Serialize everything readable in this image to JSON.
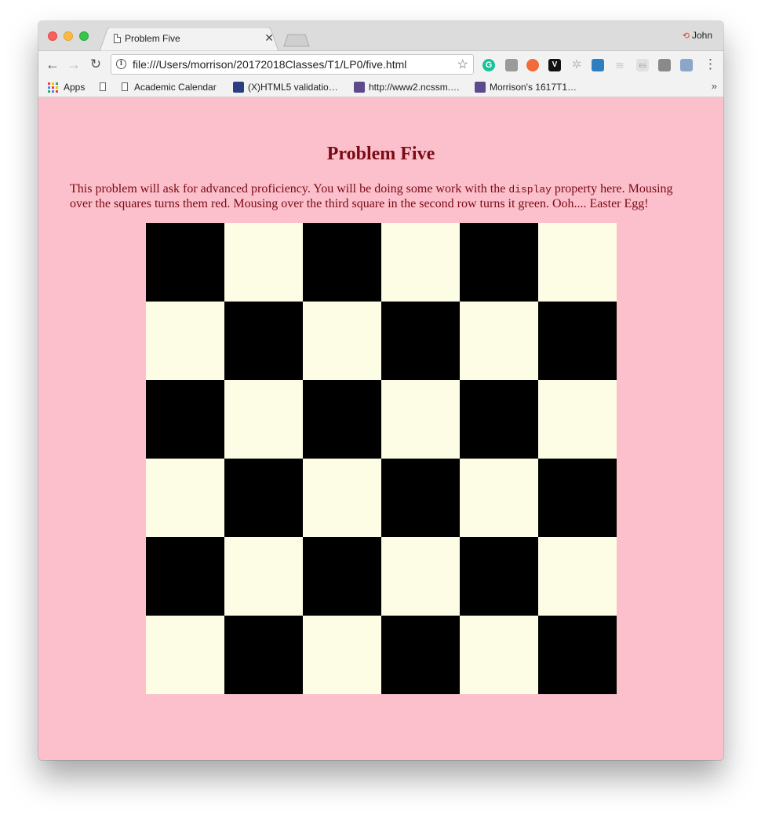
{
  "browser": {
    "tab_title": "Problem Five",
    "tab_close": "✕",
    "profile_name": "John",
    "url": "file:///Users/morrison/20172018Classes/T1/LP0/five.html",
    "bookmarks": [
      {
        "label": "Apps"
      },
      {
        "label": ""
      },
      {
        "label": "Academic Calendar"
      },
      {
        "label": "(X)HTML5 validatio…"
      },
      {
        "label": "http://www2.ncssm.…"
      },
      {
        "label": "Morrison's 1617T1…"
      }
    ],
    "bookmarks_overflow": "»",
    "extensions": [
      "grammarly-icon",
      "extension-icon",
      "orange-extension-icon",
      "vimeo-icon",
      "gray-extension-icon",
      "key-extension-icon",
      "feed-extension-icon",
      "es-extension-icon",
      "pocket-extension-icon",
      "printer-extension-icon"
    ],
    "extension_glyphs": {
      "grammarly": "G",
      "vimeo": "V",
      "es": "ES"
    }
  },
  "page": {
    "title": "Problem Five",
    "description_before_code": "This problem will ask for advanced proficiency. You will be doing some work with the ",
    "description_code": "display",
    "description_after_code": " property here. Mousing over the squares turns them red. Mousing over the third square in the second row turns it green. Ooh.... Easter Egg!",
    "colors": {
      "background": "#fbc0cb",
      "text": "#7a0a14",
      "dark_square": "#000000",
      "light_square": "#fdfce4"
    },
    "board": {
      "rows": 6,
      "cols": 6,
      "first_square": "dark"
    }
  }
}
